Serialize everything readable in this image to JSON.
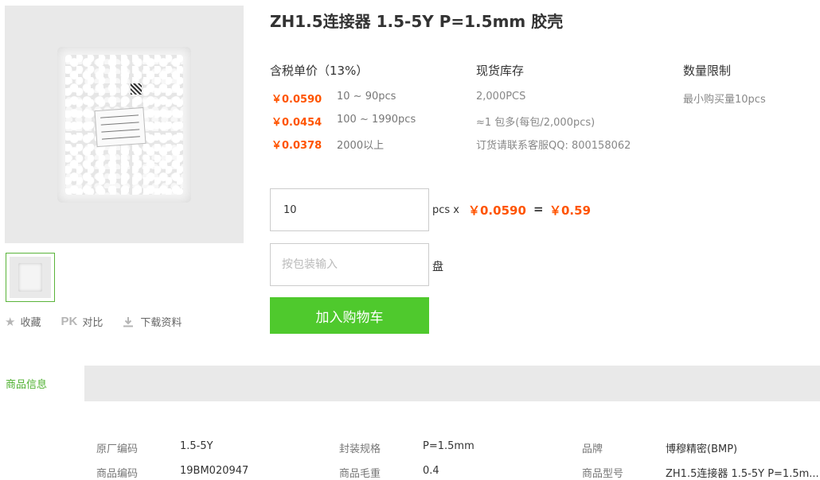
{
  "product": {
    "title": "ZH1.5连接器 1.5-5Y P=1.5mm 胶壳"
  },
  "gallery": {
    "main_alt": "product-bag-photo"
  },
  "actions": {
    "favorite_label": "收藏",
    "compare_prefix": "PK",
    "compare_label": "对比",
    "download_label": "下载资料"
  },
  "pricing": {
    "header": "含税单价（13%）",
    "tiers": [
      {
        "price": "￥0.0590",
        "range": "10 ~ 90pcs"
      },
      {
        "price": "￥0.0454",
        "range": "100 ~ 1990pcs"
      },
      {
        "price": "￥0.0378",
        "range": "2000以上"
      }
    ]
  },
  "stock": {
    "header": "现货库存",
    "lines": [
      "2,000PCS",
      "≈1 包多(每包/2,000pcs)",
      "订货请联系客服QQ: 800158062"
    ]
  },
  "limit": {
    "header": "数量限制",
    "min_text": "最小购买量10pcs"
  },
  "order": {
    "qty_value": "10",
    "qty_unit": "pcs x",
    "unit_price": "￥0.0590",
    "equals": "=",
    "total": "￥0.59",
    "pack_placeholder": "按包装输入",
    "pack_unit": "盘",
    "cart_label": "加入购物车"
  },
  "tabs": {
    "active": "商品信息"
  },
  "specs": [
    {
      "key": "原厂编码",
      "value": "1.5-5Y"
    },
    {
      "key": "封装规格",
      "value": "P=1.5mm"
    },
    {
      "key": "品牌",
      "value": "博穆精密(BMP)"
    },
    {
      "key": "商品编码",
      "value": "19BM020947"
    },
    {
      "key": "商品毛重",
      "value": "0.4"
    },
    {
      "key": "商品型号",
      "value": "ZH1.5连接器 1.5-5Y P=1.5m..."
    }
  ],
  "colors": {
    "price": "#ff5400",
    "accent_green": "#4fc92d",
    "tab_green": "#4fb130"
  }
}
